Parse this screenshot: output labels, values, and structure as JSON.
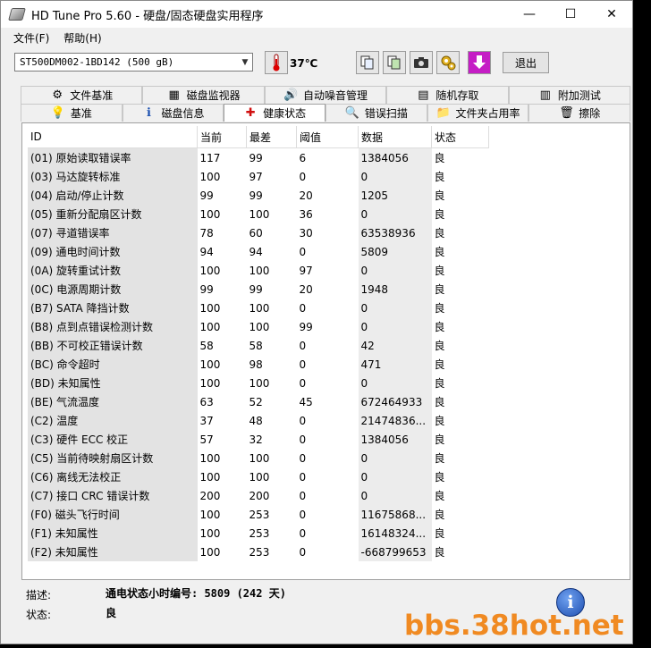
{
  "window": {
    "title": "HD Tune Pro 5.60 - 硬盘/固态硬盘实用程序",
    "minimize": "—",
    "maximize": "☐",
    "close": "✕"
  },
  "menu": [
    {
      "label": "文件(F)"
    },
    {
      "label": "帮助(H)"
    }
  ],
  "toolbar": {
    "drive": "ST500DM002-1BD142 (500 gB)",
    "temperature": "37℃",
    "exit_label": "退出"
  },
  "tabs_row1": [
    {
      "label": "文件基准",
      "icon": "file-benchmark-icon",
      "glyph": "⚙"
    },
    {
      "label": "磁盘监视器",
      "icon": "disk-monitor-icon",
      "glyph": "▦"
    },
    {
      "label": "自动噪音管理",
      "icon": "speaker-icon",
      "glyph": "🔊"
    },
    {
      "label": "随机存取",
      "icon": "random-access-icon",
      "glyph": "▤"
    },
    {
      "label": "附加测试",
      "icon": "extra-tests-icon",
      "glyph": "▥"
    }
  ],
  "tabs_row2": [
    {
      "label": "基准",
      "icon": "bulb-icon",
      "glyph": "💡"
    },
    {
      "label": "磁盘信息",
      "icon": "info-icon",
      "glyph": "ℹ"
    },
    {
      "label": "健康状态",
      "icon": "health-cross-icon",
      "glyph": "✚"
    },
    {
      "label": "错误扫描",
      "icon": "magnifier-icon",
      "glyph": "🔍"
    },
    {
      "label": "文件夹占用率",
      "icon": "folder-icon",
      "glyph": "📁"
    },
    {
      "label": "擦除",
      "icon": "trash-icon",
      "glyph": "🗑"
    }
  ],
  "table": {
    "headers": [
      "ID",
      "当前",
      "最差",
      "阈值",
      "数据",
      "状态"
    ],
    "rows": [
      [
        "(01) 原始读取错误率",
        "117",
        "99",
        "6",
        "1384056",
        "良"
      ],
      [
        "(03) 马达旋转标准",
        "100",
        "97",
        "0",
        "0",
        "良"
      ],
      [
        "(04) 启动/停止计数",
        "99",
        "99",
        "20",
        "1205",
        "良"
      ],
      [
        "(05) 重新分配扇区计数",
        "100",
        "100",
        "36",
        "0",
        "良"
      ],
      [
        "(07) 寻道错误率",
        "78",
        "60",
        "30",
        "63538936",
        "良"
      ],
      [
        "(09) 通电时间计数",
        "94",
        "94",
        "0",
        "5809",
        "良"
      ],
      [
        "(0A) 旋转重试计数",
        "100",
        "100",
        "97",
        "0",
        "良"
      ],
      [
        "(0C) 电源周期计数",
        "99",
        "99",
        "20",
        "1948",
        "良"
      ],
      [
        "(B7) SATA 降挡计数",
        "100",
        "100",
        "0",
        "0",
        "良"
      ],
      [
        "(B8) 点到点错误检测计数",
        "100",
        "100",
        "99",
        "0",
        "良"
      ],
      [
        "(BB) 不可校正错误计数",
        "58",
        "58",
        "0",
        "42",
        "良"
      ],
      [
        "(BC) 命令超时",
        "100",
        "98",
        "0",
        "471",
        "良"
      ],
      [
        "(BD) 未知属性",
        "100",
        "100",
        "0",
        "0",
        "良"
      ],
      [
        "(BE) 气流温度",
        "63",
        "52",
        "45",
        "672464933",
        "良"
      ],
      [
        "(C2) 温度",
        "37",
        "48",
        "0",
        "21474836...",
        "良"
      ],
      [
        "(C3) 硬件 ECC 校正",
        "57",
        "32",
        "0",
        "1384056",
        "良"
      ],
      [
        "(C5) 当前待映射扇区计数",
        "100",
        "100",
        "0",
        "0",
        "良"
      ],
      [
        "(C6) 离线无法校正",
        "100",
        "100",
        "0",
        "0",
        "良"
      ],
      [
        "(C7) 接口 CRC 错误计数",
        "200",
        "200",
        "0",
        "0",
        "良"
      ],
      [
        "(F0) 磁头飞行时间",
        "100",
        "253",
        "0",
        "11675868...",
        "良"
      ],
      [
        "(F1) 未知属性",
        "100",
        "253",
        "0",
        "16148324...",
        "良"
      ],
      [
        "(F2) 未知属性",
        "100",
        "253",
        "0",
        "-668799653",
        "良"
      ]
    ]
  },
  "footer": {
    "desc_label": "描述:",
    "desc_value": "通电状态小时编号: 5809 (242 天)",
    "status_label": "状态:",
    "status_value": "良"
  },
  "watermark": "bbs.38hot.net"
}
